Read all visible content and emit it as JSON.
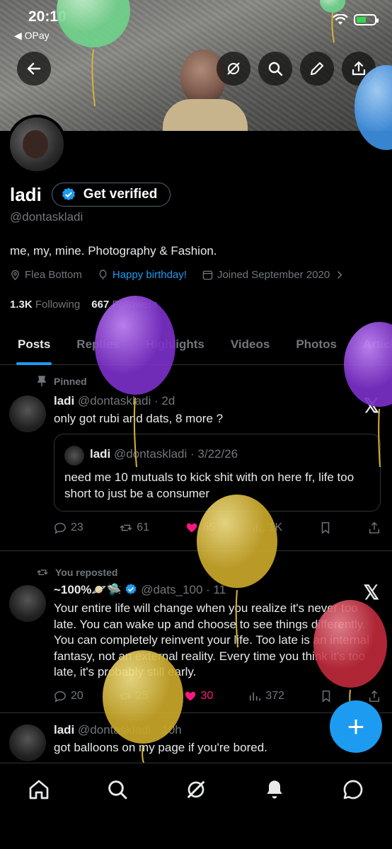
{
  "status_bar": {
    "time": "20:10",
    "back_app": "◀ OPay"
  },
  "profile": {
    "name": "ladi",
    "verify_label": "Get verified",
    "handle": "@dontaskladi",
    "bio": "me, my, mine. Photography & Fashion.",
    "location": "Flea Bottom",
    "birthday": "Happy birthday!",
    "joined": "Joined September 2020",
    "following_count": "1.3K",
    "following_label": "Following",
    "followers_count": "667",
    "followers_label": "Followers"
  },
  "tabs": [
    "Posts",
    "Replies",
    "Highlights",
    "Videos",
    "Photos",
    "Articles"
  ],
  "posts": [
    {
      "context": "Pinned",
      "name": "ladi",
      "meta": "@dontaskladi · 2d",
      "text": "only got rubi and dats, 8 more ?",
      "quote": {
        "name": "ladi",
        "meta": "@dontaskladi · 3/22/26",
        "text": "need me 10 mutuals to kick shit with on here fr, life too short to just be a consumer"
      },
      "replies": "23",
      "reposts": "61",
      "likes": "65",
      "views": "1K"
    },
    {
      "context": "You reposted",
      "name": "~100%🪐🛸",
      "meta": "@dats_100 · 11",
      "text": "Your entire life will change when you realize it's never too late. You can wake up and choose to see things differently. You can completely reinvent your life. Too late is an internal fantasy, not an external reality. Every time you think it's too late, it's probably still early.",
      "replies": "20",
      "reposts": "25",
      "likes": "30",
      "views": "372"
    },
    {
      "name": "ladi",
      "meta": "@dontaskladi · 10h",
      "text": "got balloons on my page if you're bored."
    }
  ],
  "fab_label": "+",
  "x_logo": "𝕏",
  "colors": {
    "accent": "#1d9bf0",
    "like": "#f91880",
    "verified": "#1d9bf0"
  }
}
